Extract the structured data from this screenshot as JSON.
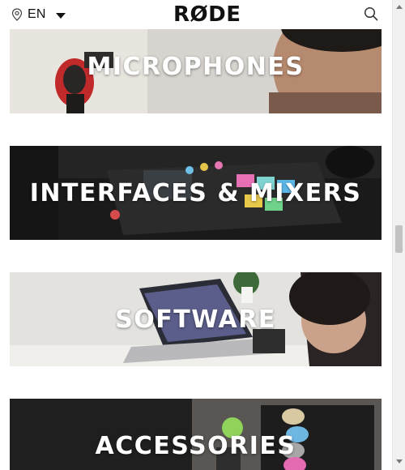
{
  "header": {
    "language": "EN",
    "logo_text": "RØDE"
  },
  "categories": [
    {
      "label": "MICROPHONES"
    },
    {
      "label": "INTERFACES & MIXERS"
    },
    {
      "label": "SOFTWARE"
    },
    {
      "label": "ACCESSORIES"
    }
  ],
  "icons": {
    "location": "location-pin-icon",
    "dropdown": "chevron-down-icon",
    "search": "search-icon"
  },
  "colors": {
    "text": "#111111",
    "label": "#ffffff",
    "scroll_track": "#f1f1f1",
    "scroll_thumb": "#c2c2c2"
  }
}
